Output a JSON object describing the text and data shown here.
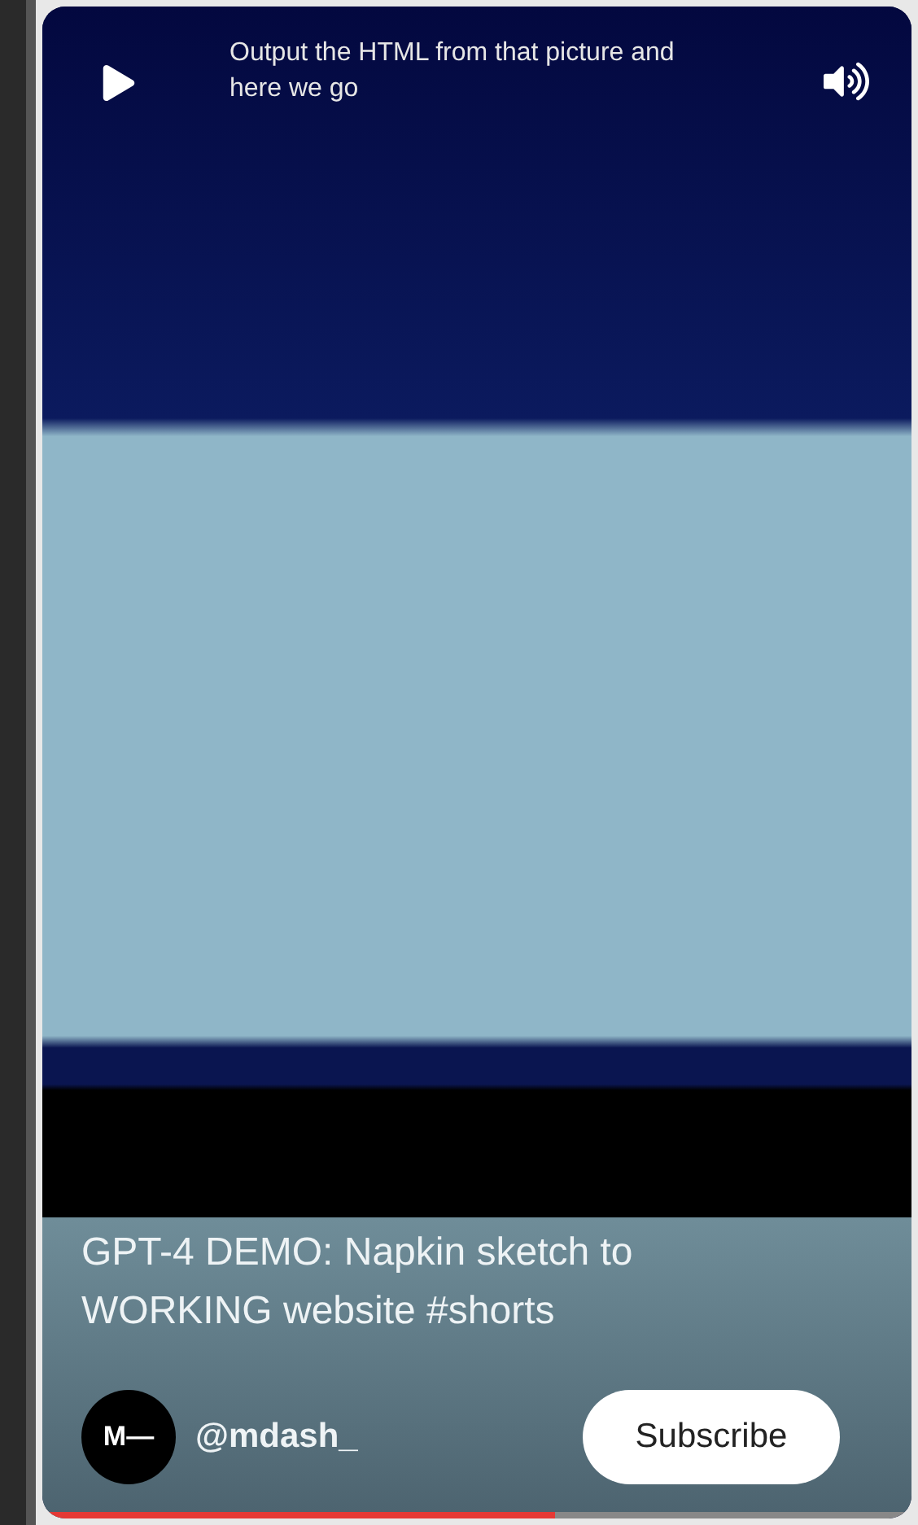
{
  "player": {
    "caption": "Output the HTML from that picture and here we go",
    "paused": true,
    "muted": false
  },
  "video": {
    "title": "GPT-4 DEMO: Napkin sketch to WORKING website #shorts"
  },
  "channel": {
    "avatar_text": "M—",
    "handle": "@mdash_"
  },
  "subscribe_button": {
    "label": "Subscribe"
  },
  "progress": {
    "level": 0.59
  }
}
